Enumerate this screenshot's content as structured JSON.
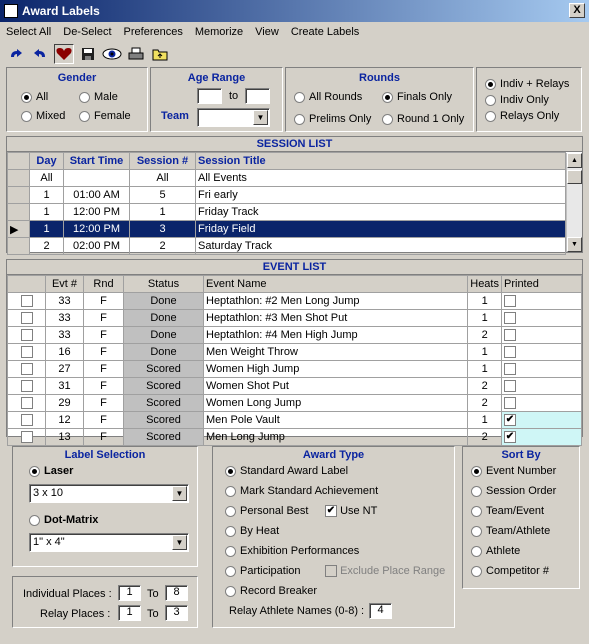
{
  "window": {
    "title": "Award Labels",
    "close_glyph": "X"
  },
  "menu": [
    "Select All",
    "De-Select",
    "Preferences",
    "Memorize",
    "View",
    "Create Labels"
  ],
  "toolbar": [
    "redo-icon",
    "undo-icon",
    "heart-icon",
    "save-icon",
    "eye-icon",
    "print-icon",
    "folder-up-icon"
  ],
  "gender": {
    "title": "Gender",
    "options": [
      "All",
      "Male",
      "Mixed",
      "Female"
    ],
    "selected": "All"
  },
  "age_range": {
    "title": "Age Range",
    "from": "",
    "to_label": "to",
    "to": "",
    "team_label": "Team",
    "team_value": ""
  },
  "rounds": {
    "title": "Rounds",
    "options": [
      "All Rounds",
      "Finals Only",
      "Prelims Only",
      "Round 1 Only"
    ],
    "selected": "Finals Only"
  },
  "relay_filter": {
    "options": [
      "Indiv + Relays",
      "Indiv Only",
      "Relays Only"
    ],
    "selected": "Indiv + Relays"
  },
  "session_list": {
    "title": "SESSION LIST",
    "columns": [
      "Day",
      "Start Time",
      "Session #",
      "Session Title"
    ],
    "rows": [
      [
        "All",
        "",
        "All",
        "All Events"
      ],
      [
        "1",
        "01:00 AM",
        "5",
        "Fri early"
      ],
      [
        "1",
        "12:00 PM",
        "1",
        "Friday Track"
      ],
      [
        "1",
        "12:00 PM",
        "3",
        "Friday Field"
      ],
      [
        "2",
        "02:00 PM",
        "2",
        "Saturday Track"
      ]
    ],
    "selected_index": 3
  },
  "event_list": {
    "title": "EVENT LIST",
    "columns": [
      "",
      "Evt #",
      "Rnd",
      "Status",
      "Event Name",
      "Heats",
      "Printed"
    ],
    "rows": [
      {
        "evt": "33",
        "rnd": "F",
        "status": "Done",
        "name": "Heptathlon: #2 Men Long Jump",
        "heats": "1",
        "printed": false
      },
      {
        "evt": "33",
        "rnd": "F",
        "status": "Done",
        "name": "Heptathlon: #3 Men Shot Put",
        "heats": "1",
        "printed": false
      },
      {
        "evt": "33",
        "rnd": "F",
        "status": "Done",
        "name": "Heptathlon: #4 Men High Jump",
        "heats": "2",
        "printed": false
      },
      {
        "evt": "16",
        "rnd": "F",
        "status": "Done",
        "name": "Men Weight Throw",
        "heats": "1",
        "printed": false
      },
      {
        "evt": "27",
        "rnd": "F",
        "status": "Scored",
        "name": "Women High Jump",
        "heats": "1",
        "printed": false
      },
      {
        "evt": "31",
        "rnd": "F",
        "status": "Scored",
        "name": "Women Shot Put",
        "heats": "2",
        "printed": false
      },
      {
        "evt": "29",
        "rnd": "F",
        "status": "Scored",
        "name": "Women Long Jump",
        "heats": "2",
        "printed": false
      },
      {
        "evt": "12",
        "rnd": "F",
        "status": "Scored",
        "name": "Men Pole Vault",
        "heats": "1",
        "printed": true
      },
      {
        "evt": "13",
        "rnd": "F",
        "status": "Scored",
        "name": "Men Long Jump",
        "heats": "2",
        "printed": true
      }
    ]
  },
  "label_selection": {
    "title": "Label Selection",
    "laser_label": "Laser",
    "laser_value": "3 x 10",
    "dot_label": "Dot-Matrix",
    "dot_value": "1\" x 4\"",
    "selected": "Laser",
    "indiv_label": "Individual Places :",
    "indiv_from": "1",
    "indiv_to": "8",
    "relay_label": "Relay Places :",
    "relay_from": "1",
    "relay_to": "3",
    "to_label": "To"
  },
  "award_type": {
    "title": "Award Type",
    "options": [
      "Standard Award Label",
      "Mark Standard Achievement",
      "Personal Best",
      "By Heat",
      "Exhibition Performances",
      "Participation",
      "Record Breaker"
    ],
    "selected": "Standard Award Label",
    "use_nt_label": "Use NT",
    "use_nt": true,
    "exclude_label": "Exclude Place Range",
    "relay_names_label": "Relay Athlete Names (0-8) :",
    "relay_names_value": "4"
  },
  "sort_by": {
    "title": "Sort By",
    "options": [
      "Event Number",
      "Session Order",
      "Team/Event",
      "Team/Athlete",
      "Athlete",
      "Competitor #"
    ],
    "selected": "Event Number"
  }
}
